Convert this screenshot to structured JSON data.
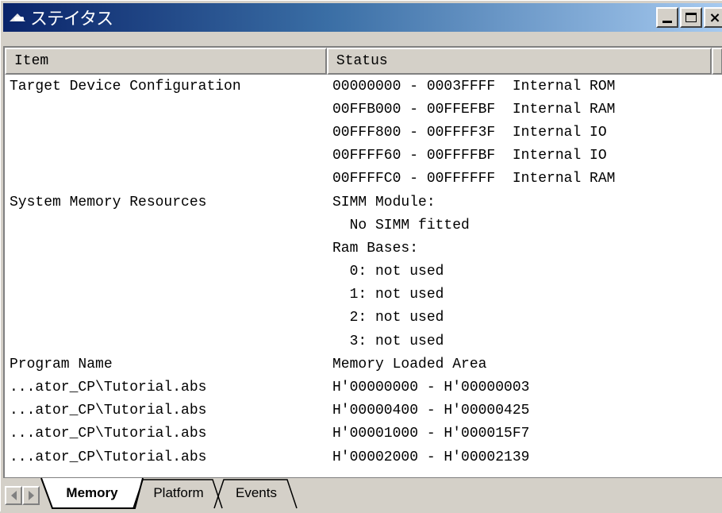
{
  "window": {
    "title": "ステイタス",
    "buttons": {
      "minimize": "_",
      "maximize": "□",
      "close": "×"
    }
  },
  "columns": {
    "item": "Item",
    "status": "Status"
  },
  "rows": [
    {
      "item": "Target Device Configuration",
      "status": "00000000 - 0003FFFF  Internal ROM"
    },
    {
      "item": "",
      "status": "00FFB000 - 00FFEFBF  Internal RAM"
    },
    {
      "item": "",
      "status": "00FFF800 - 00FFFF3F  Internal IO"
    },
    {
      "item": "",
      "status": "00FFFF60 - 00FFFFBF  Internal IO"
    },
    {
      "item": "",
      "status": "00FFFFC0 - 00FFFFFF  Internal RAM"
    },
    {
      "item": "System Memory Resources",
      "status": "SIMM Module:"
    },
    {
      "item": "",
      "status": "  No SIMM fitted"
    },
    {
      "item": "",
      "status": "Ram Bases:"
    },
    {
      "item": "",
      "status": "  0: not used"
    },
    {
      "item": "",
      "status": "  1: not used"
    },
    {
      "item": "",
      "status": "  2: not used"
    },
    {
      "item": "",
      "status": "  3: not used"
    },
    {
      "item": "Program Name",
      "status": "Memory Loaded Area"
    },
    {
      "item": "...ator_CP\\Tutorial.abs",
      "status": "H'00000000 - H'00000003"
    },
    {
      "item": "...ator_CP\\Tutorial.abs",
      "status": "H'00000400 - H'00000425"
    },
    {
      "item": "...ator_CP\\Tutorial.abs",
      "status": "H'00001000 - H'000015F7"
    },
    {
      "item": "...ator_CP\\Tutorial.abs",
      "status": "H'00002000 - H'00002139"
    }
  ],
  "tabs": [
    {
      "label": "Memory",
      "active": true
    },
    {
      "label": "Platform",
      "active": false
    },
    {
      "label": "Events",
      "active": false
    }
  ],
  "icons": {
    "app": "window-app-icon",
    "scroll_left": "scroll-left-icon",
    "scroll_right": "scroll-right-icon"
  }
}
